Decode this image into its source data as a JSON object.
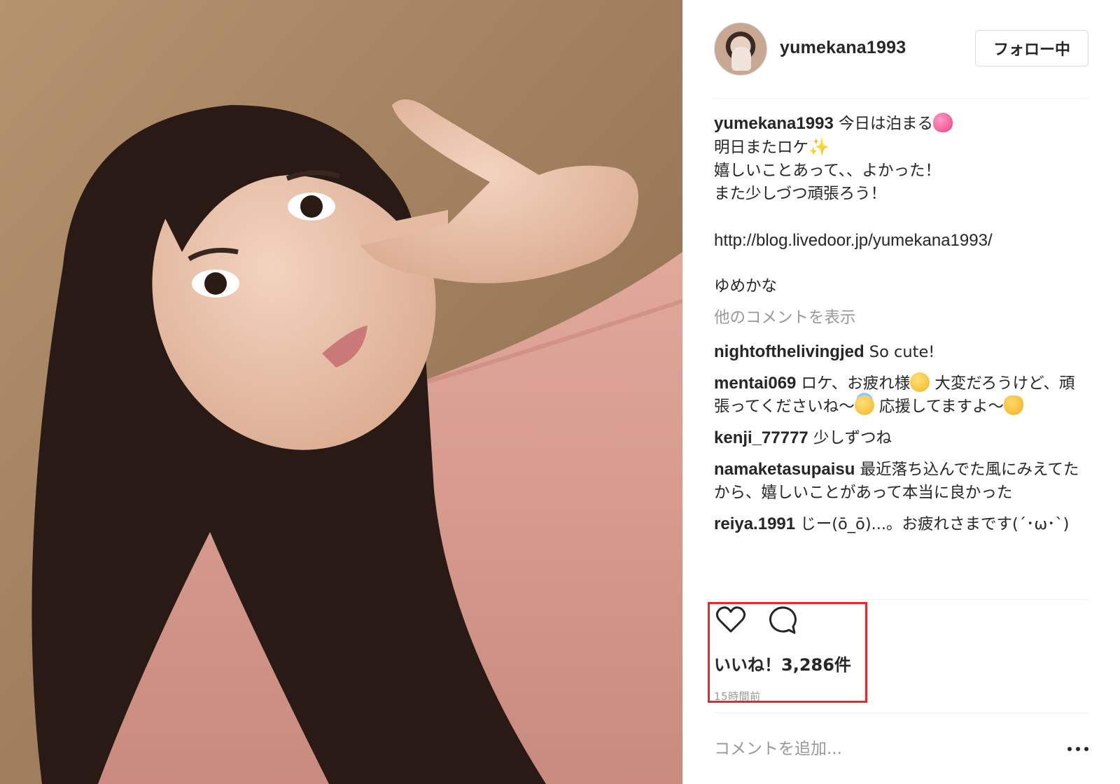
{
  "post": {
    "username": "yumekana1993",
    "follow_label": "フォロー中",
    "caption": {
      "user": "yumekana1993",
      "line1": " 今日は泊まる",
      "line1_emoji": "heart-emoji",
      "line2": "明日またロケ",
      "line2_emoji": "sparkles-emoji",
      "line3": "嬉しいことあって、、よかった！",
      "line4": "また少しづつ頑張ろう！",
      "link": "http://blog.livedoor.jp/yumekana1993/",
      "signature": "ゆめかな"
    },
    "more_comments_label": "他のコメントを表示",
    "comments": [
      {
        "user": "nightofthelivingjed",
        "text": " So cute!"
      },
      {
        "user": "mentai069",
        "text_a": " ロケ、お疲れ様",
        "emoji_a": "hugging-face-emoji",
        "text_b": " 大変だろうけど、頑張ってくださいね〜",
        "emoji_b": "halo-face-emoji",
        "text_c": " 応援してますよ〜",
        "emoji_c": "waving-hand-emoji"
      },
      {
        "user": "kenji_77777",
        "text": " 少しずつね"
      },
      {
        "user": "namaketasupaisu",
        "text": " 最近落ち込んでた風にみえてたから、嬉しいことがあって本当に良かった"
      },
      {
        "user": "reiya.1991",
        "text": " じー(ō_ō)...。お疲れさまです(´･ω･`)"
      }
    ],
    "likes_label": "いいね！3,286件",
    "timestamp": "15時間前",
    "comment_placeholder": "コメントを追加...",
    "icons": {
      "like": "heart-icon",
      "comment": "comment-bubble-icon",
      "options": "more-options-icon"
    },
    "colors": {
      "highlight": "#e8282a",
      "text": "#262626",
      "muted": "#999999",
      "border": "#dbdbdb"
    }
  }
}
